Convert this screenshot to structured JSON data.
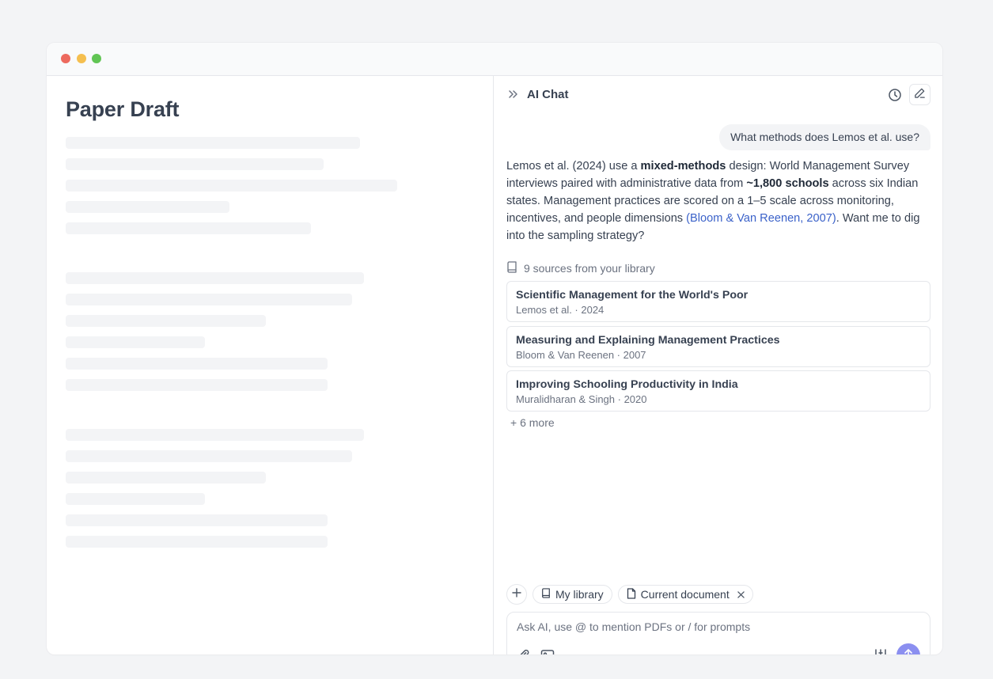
{
  "document": {
    "title": "Paper Draft"
  },
  "chat": {
    "title": "AI Chat",
    "user_message": "What methods does Lemos et al. use?",
    "ai_response": {
      "part1": "Lemos et al. (2024) use a ",
      "bold1": "mixed-methods",
      "part2": " design: World Management Survey interviews paired with administrative data from ",
      "bold2": "~1,800 schools",
      "part3": " across six Indian states. Management practices are scored on a 1–5 scale across monitoring, incentives, and people dimensions ",
      "citation": "(Bloom & Van Reenen, 2007)",
      "part4": ". Want me to dig into the sampling strategy?"
    },
    "sources_label": "9 sources from your library",
    "sources": [
      {
        "title": "Scientific Management for the World's Poor",
        "meta": "Lemos et al. · 2024"
      },
      {
        "title": "Measuring and Explaining Management Practices",
        "meta": "Bloom & Van Reenen · 2007"
      },
      {
        "title": "Improving Schooling Productivity in India",
        "meta": "Muralidharan & Singh · 2020"
      }
    ],
    "more_sources": "+ 6 more",
    "context_chips": {
      "library": "My library",
      "current_document": "Current document"
    },
    "composer": {
      "placeholder": "Ask AI, use @ to mention PDFs or / for prompts",
      "value": ""
    }
  },
  "icons": {
    "collapse": "double-chevron-right-icon",
    "history": "clock-icon",
    "new_chat": "pencil-icon",
    "sources": "book-icon",
    "add": "plus-icon",
    "library": "book-icon",
    "document": "file-icon",
    "remove": "close-icon",
    "attach": "paperclip-icon",
    "image": "image-icon",
    "settings": "sliders-icon",
    "send": "arrow-up-icon"
  },
  "colors": {
    "accent_send": "#8b8ff0",
    "citation_link": "#3b62c9",
    "window_dot_red": "#ed6a5e",
    "window_dot_yellow": "#f5bf4f",
    "window_dot_green": "#61c554"
  }
}
